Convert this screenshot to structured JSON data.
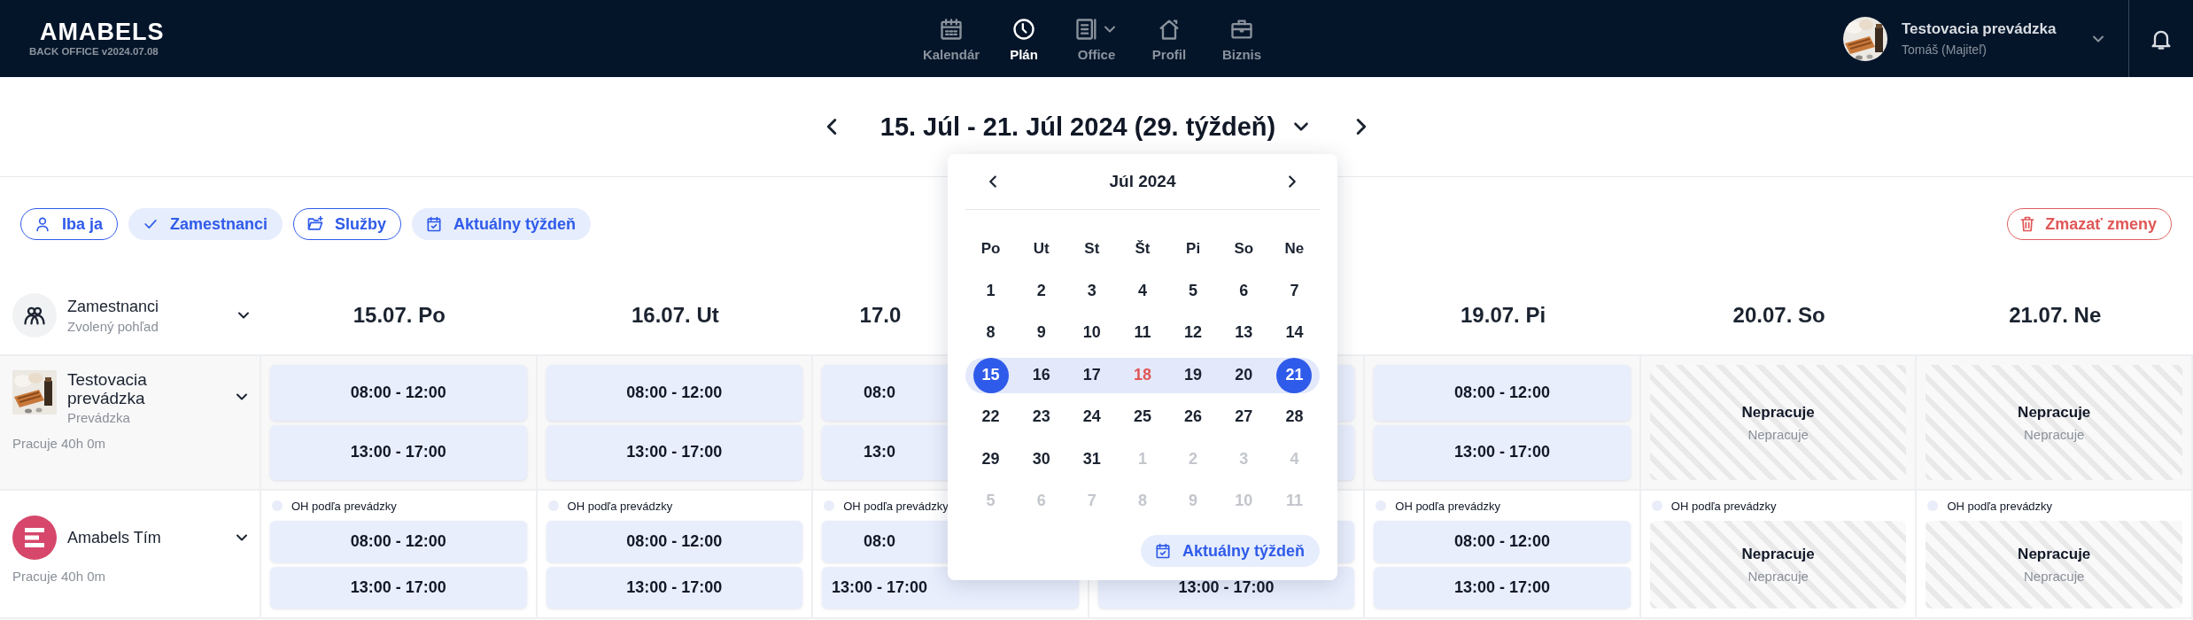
{
  "header": {
    "logo": "AMABELS",
    "version": "BACK OFFICE v2024.07.08",
    "nav": [
      {
        "label": "Kalendár",
        "kind": "calendar",
        "selected": false,
        "dropdown": false
      },
      {
        "label": "Plán",
        "kind": "clock",
        "selected": true,
        "dropdown": false
      },
      {
        "label": "Office",
        "kind": "document",
        "selected": false,
        "dropdown": true
      },
      {
        "label": "Profil",
        "kind": "house",
        "selected": false,
        "dropdown": false
      },
      {
        "label": "Biznis",
        "kind": "briefcase",
        "selected": false,
        "dropdown": false
      }
    ],
    "account": {
      "name": "Testovacia prevádzka",
      "role": "Tomáš (Majiteľ)"
    }
  },
  "week_nav": {
    "title": "15. Júl - 21. Júl 2024 (29. týždeň)"
  },
  "filters": [
    {
      "label": "Iba ja",
      "kind": "person",
      "selected": false
    },
    {
      "label": "Zamestnanci",
      "kind": "check",
      "selected": true
    },
    {
      "label": "Služby",
      "kind": "folder",
      "selected": false
    },
    {
      "label": "Aktuálny týždeň",
      "kind": "calendar",
      "selected": true
    }
  ],
  "delete_button": "Zmazať zmeny",
  "table": {
    "view": {
      "title": "Zamestnanci",
      "subtitle": "Zvolený pohľad"
    },
    "days": [
      {
        "label": "15.07. Po",
        "kind": "full"
      },
      {
        "label": "16.07. Ut",
        "kind": "full"
      },
      {
        "label": "17.0",
        "kind": "clipped"
      },
      {
        "kind": "covered"
      },
      {
        "label": "19.07. Pi",
        "kind": "full"
      },
      {
        "label": "20.07. So",
        "kind": "full"
      },
      {
        "label": "21.07. Ne",
        "kind": "full"
      }
    ],
    "rows": [
      {
        "kind": "venue",
        "name": "Testovacia prevádzka",
        "type": "Prevádzka",
        "hours": "Pracuje 40h 0m",
        "cells": [
          {
            "kind": "shifts",
            "shifts": [
              {
                "time": "08:00 - 12:00"
              },
              {
                "time": "13:00 - 17:00"
              }
            ]
          },
          {
            "kind": "shifts",
            "shifts": [
              {
                "time": "08:00 - 12:00"
              },
              {
                "time": "13:00 - 17:00"
              }
            ]
          },
          {
            "kind": "shifts",
            "shifts": [
              {
                "time": "08:0"
              },
              {
                "time": "13:0"
              }
            ]
          },
          {
            "kind": "shifts",
            "shifts": [
              {
                "covered": true
              },
              {
                "covered": true
              }
            ]
          },
          {
            "kind": "shifts",
            "shifts": [
              {
                "time": "08:00 - 12:00"
              },
              {
                "time": "13:00 - 17:00"
              }
            ]
          },
          {
            "kind": "off",
            "title": "Nepracuje",
            "subtitle": "Nepracuje"
          },
          {
            "kind": "off",
            "title": "Nepracuje",
            "subtitle": "Nepracuje"
          }
        ]
      },
      {
        "kind": "team",
        "name": "Amabels Tím",
        "hours": "Pracuje 40h 0m",
        "cells": [
          {
            "kind": "shifts",
            "note": {
              "text": "OH podľa prevádzky"
            },
            "shifts": [
              {
                "time": "08:00 - 12:00"
              },
              {
                "time": "13:00 - 17:00"
              }
            ]
          },
          {
            "kind": "shifts",
            "note": {
              "text": "OH podľa prevádzky"
            },
            "shifts": [
              {
                "time": "08:00 - 12:00"
              },
              {
                "time": "13:00 - 17:00"
              }
            ]
          },
          {
            "kind": "shifts",
            "note": {
              "text": "OH podľa prevádzky"
            },
            "shifts": [
              {
                "time": "08:0"
              },
              {
                "time": "13:00 - 17:00"
              }
            ]
          },
          {
            "kind": "shifts",
            "note": {
              "covered": true
            },
            "shifts": [
              {
                "covered": true
              },
              {
                "time": "13:00 - 17:00"
              }
            ]
          },
          {
            "kind": "shifts",
            "note": {
              "text": "OH podľa prevádzky"
            },
            "shifts": [
              {
                "time": "08:00 - 12:00"
              },
              {
                "time": "13:00 - 17:00"
              }
            ]
          },
          {
            "kind": "off",
            "note": {
              "text": "OH podľa prevádzky"
            },
            "title": "Nepracuje",
            "subtitle": "Nepracuje"
          },
          {
            "kind": "off",
            "note": {
              "text": "OH podľa prevádzky"
            },
            "title": "Nepracuje",
            "subtitle": "Nepracuje"
          }
        ]
      }
    ]
  },
  "calendar": {
    "title": "Júl 2024",
    "weekdays": [
      "Po",
      "Ut",
      "St",
      "Št",
      "Pi",
      "So",
      "Ne"
    ],
    "button": "Aktuálny týždeň",
    "weeks": [
      {
        "in_range": false,
        "days": [
          {
            "label": "1",
            "kind": "current",
            "selected": false
          },
          {
            "label": "2",
            "kind": "current",
            "selected": false
          },
          {
            "label": "3",
            "kind": "current",
            "selected": false
          },
          {
            "label": "4",
            "kind": "current",
            "selected": false
          },
          {
            "label": "5",
            "kind": "current",
            "selected": false
          },
          {
            "label": "6",
            "kind": "current",
            "selected": false
          },
          {
            "label": "7",
            "kind": "current",
            "selected": false
          }
        ]
      },
      {
        "in_range": false,
        "days": [
          {
            "label": "8",
            "kind": "current",
            "selected": false
          },
          {
            "label": "9",
            "kind": "current",
            "selected": false
          },
          {
            "label": "10",
            "kind": "current",
            "selected": false
          },
          {
            "label": "11",
            "kind": "current",
            "selected": false
          },
          {
            "label": "12",
            "kind": "current",
            "selected": false
          },
          {
            "label": "13",
            "kind": "current",
            "selected": false
          },
          {
            "label": "14",
            "kind": "current",
            "selected": false
          }
        ]
      },
      {
        "in_range": true,
        "days": [
          {
            "label": "15",
            "kind": "current",
            "selected": true
          },
          {
            "label": "16",
            "kind": "current",
            "selected": false
          },
          {
            "label": "17",
            "kind": "current",
            "selected": false
          },
          {
            "label": "18",
            "kind": "today",
            "selected": false
          },
          {
            "label": "19",
            "kind": "current",
            "selected": false
          },
          {
            "label": "20",
            "kind": "current",
            "selected": false
          },
          {
            "label": "21",
            "kind": "current",
            "selected": true
          }
        ]
      },
      {
        "in_range": false,
        "days": [
          {
            "label": "22",
            "kind": "current",
            "selected": false
          },
          {
            "label": "23",
            "kind": "current",
            "selected": false
          },
          {
            "label": "24",
            "kind": "current",
            "selected": false
          },
          {
            "label": "25",
            "kind": "current",
            "selected": false
          },
          {
            "label": "26",
            "kind": "current",
            "selected": false
          },
          {
            "label": "27",
            "kind": "current",
            "selected": false
          },
          {
            "label": "28",
            "kind": "current",
            "selected": false
          }
        ]
      },
      {
        "in_range": false,
        "days": [
          {
            "label": "29",
            "kind": "current",
            "selected": false
          },
          {
            "label": "30",
            "kind": "current",
            "selected": false
          },
          {
            "label": "31",
            "kind": "current",
            "selected": false
          },
          {
            "label": "1",
            "kind": "adjacent",
            "selected": false
          },
          {
            "label": "2",
            "kind": "adjacent",
            "selected": false
          },
          {
            "label": "3",
            "kind": "adjacent",
            "selected": false
          },
          {
            "label": "4",
            "kind": "adjacent",
            "selected": false
          }
        ]
      },
      {
        "in_range": false,
        "days": [
          {
            "label": "5",
            "kind": "adjacent",
            "selected": false
          },
          {
            "label": "6",
            "kind": "adjacent",
            "selected": false
          },
          {
            "label": "7",
            "kind": "adjacent",
            "selected": false
          },
          {
            "label": "8",
            "kind": "adjacent",
            "selected": false
          },
          {
            "label": "9",
            "kind": "adjacent",
            "selected": false
          },
          {
            "label": "10",
            "kind": "adjacent",
            "selected": false
          },
          {
            "label": "11",
            "kind": "adjacent",
            "selected": false
          }
        ]
      }
    ]
  }
}
